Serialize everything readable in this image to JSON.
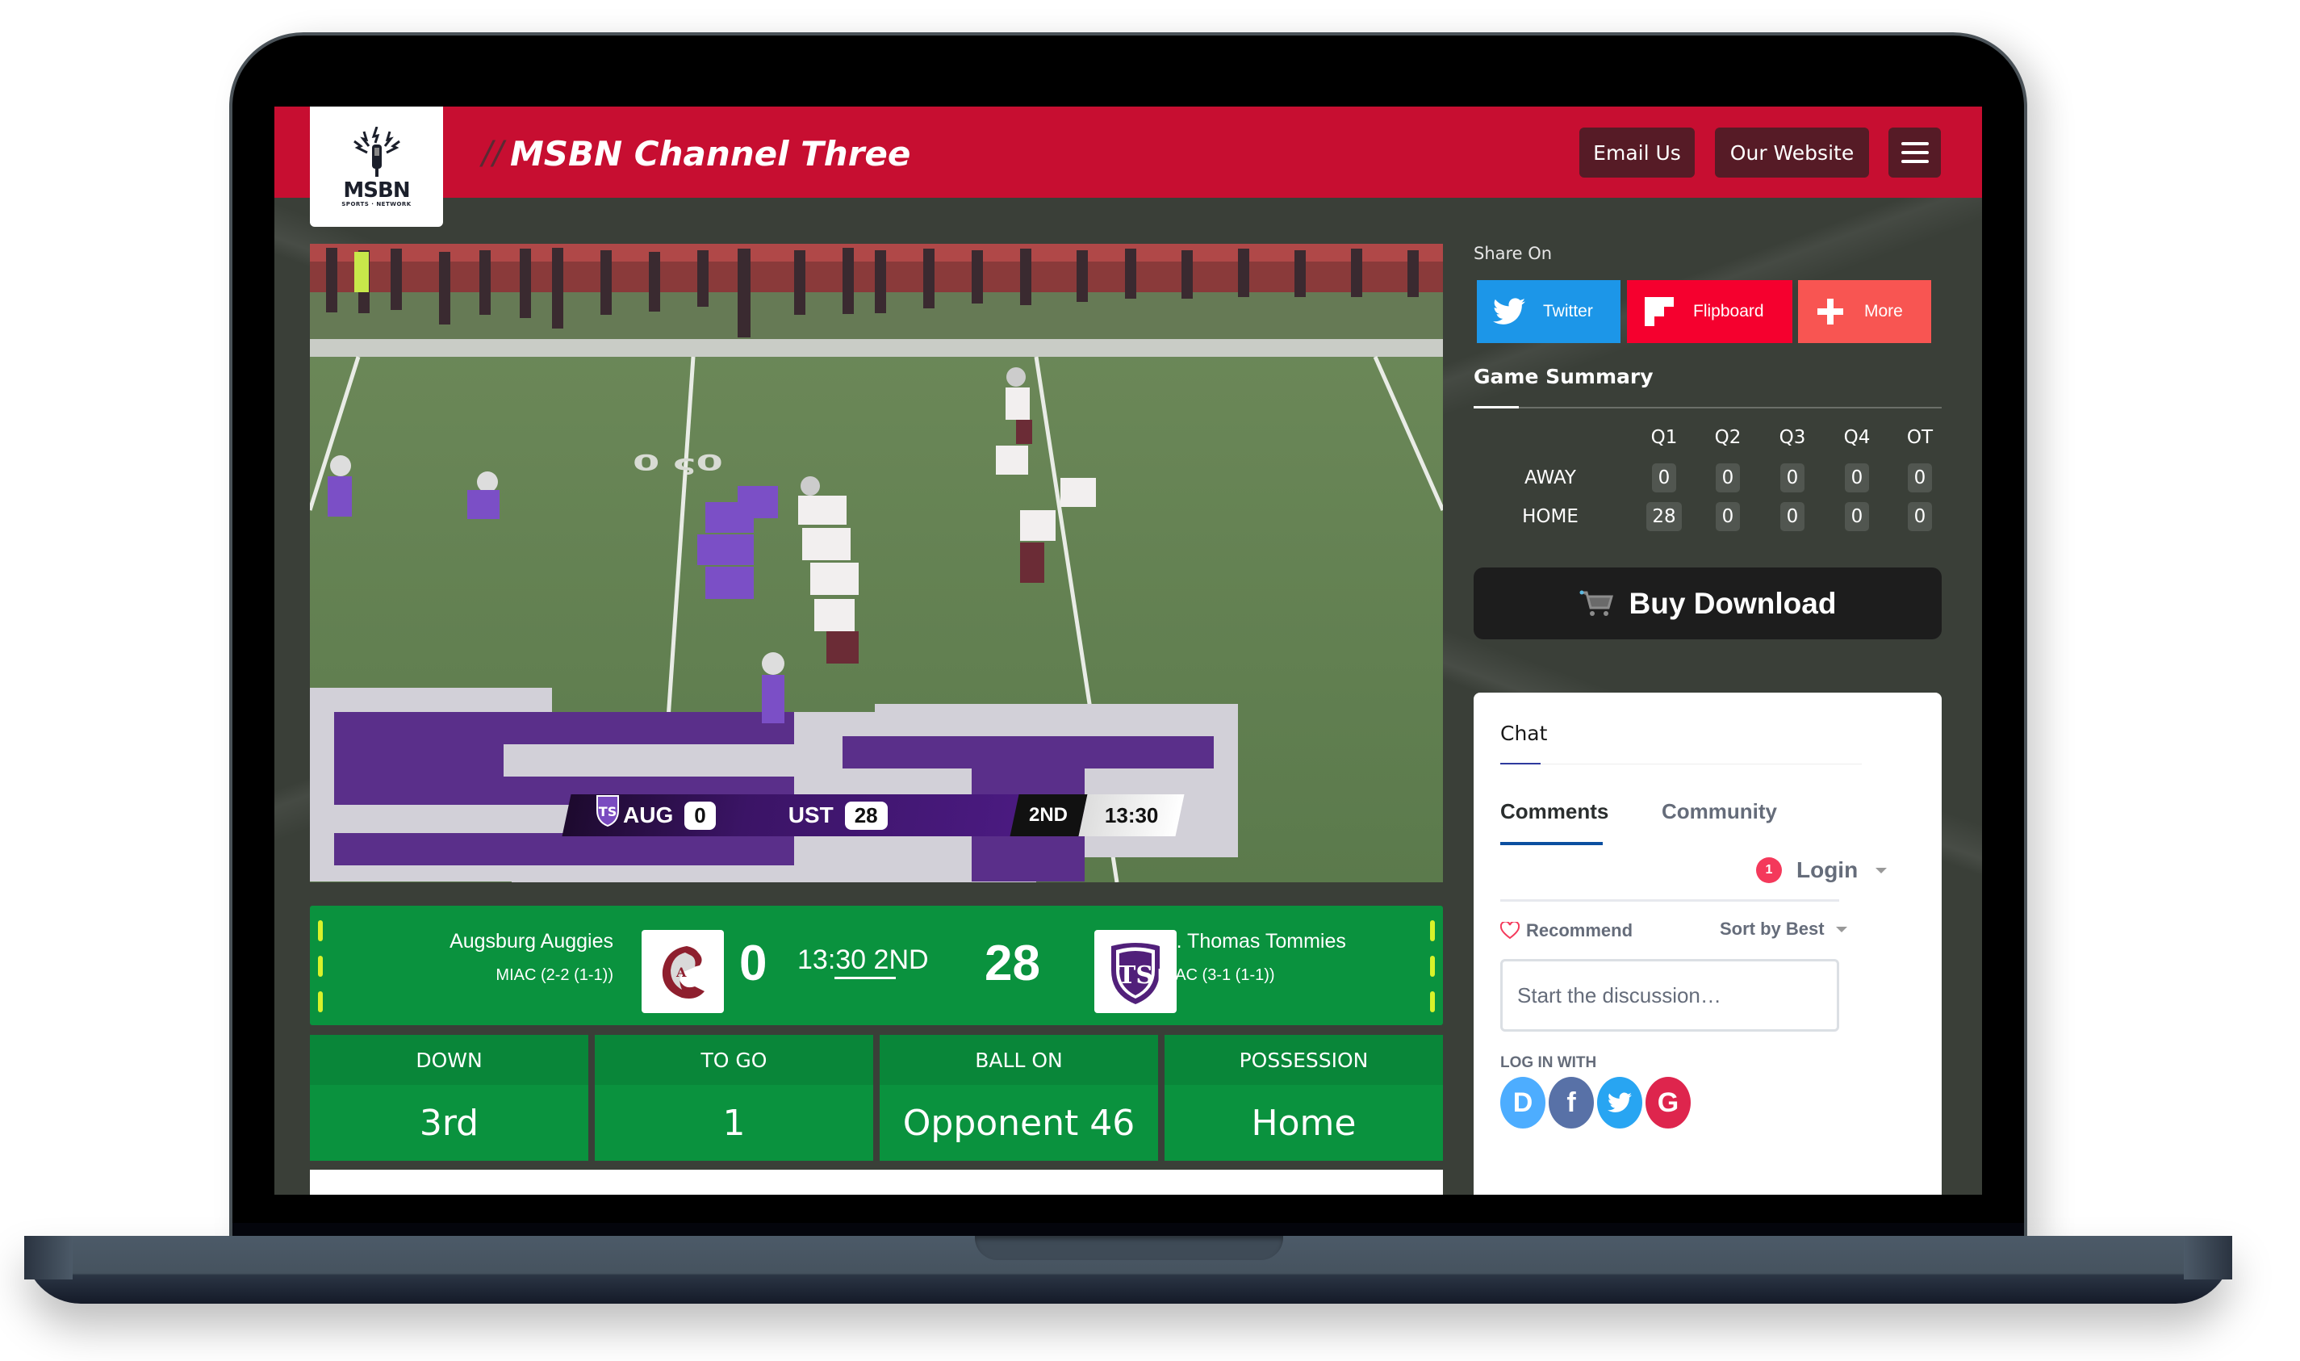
{
  "header": {
    "logo_text": "MSBN",
    "logo_subtext": "SPORTS · NETWORK",
    "title_prefix": "//",
    "title": "MSBN Channel Three",
    "buttons": {
      "email": "Email Us",
      "website": "Our Website"
    },
    "menu_icon": "hamburger-icon"
  },
  "video": {
    "score_bug": {
      "away_abbr": "AUG",
      "away_score": "0",
      "home_abbr": "UST",
      "home_score": "28",
      "period": "2ND",
      "clock": "13:30"
    }
  },
  "scoreboard": {
    "away": {
      "name": "Augsburg Auggies",
      "conference": "MIAC (2-2 (1-1))",
      "score": "0"
    },
    "home": {
      "name": "St. Thomas Tommies",
      "conference": "MIAC (3-1 (1-1))",
      "score": "28"
    },
    "clock": "13:30 2ND",
    "colors": {
      "field_green": "#0a923e",
      "yard_marker": "#d8f22a"
    }
  },
  "situation": [
    {
      "label": "DOWN",
      "value": "3rd"
    },
    {
      "label": "TO GO",
      "value": "1"
    },
    {
      "label": "BALL ON",
      "value": "Opponent 46"
    },
    {
      "label": "POSSESSION",
      "value": "Home"
    }
  ],
  "share": {
    "label": "Share On",
    "buttons": [
      {
        "label": "Twitter",
        "icon": "twitter-icon",
        "color": "#1c96e8"
      },
      {
        "label": "Flipboard",
        "icon": "flipboard-icon",
        "color": "#f5002e"
      },
      {
        "label": "More",
        "icon": "plus-icon",
        "color": "#f85552"
      }
    ]
  },
  "game_summary": {
    "title": "Game Summary",
    "columns": [
      "Q1",
      "Q2",
      "Q3",
      "Q4",
      "OT"
    ],
    "rows": [
      {
        "label": "AWAY",
        "values": [
          "0",
          "0",
          "0",
          "0",
          "0"
        ]
      },
      {
        "label": "HOME",
        "values": [
          "28",
          "0",
          "0",
          "0",
          "0"
        ]
      }
    ]
  },
  "buy_download": {
    "label": "Buy Download",
    "icon": "cart-icon"
  },
  "chat": {
    "title": "Chat",
    "tabs": [
      "Comments",
      "Community"
    ],
    "active_tab": "Comments",
    "notification_count": "1",
    "login_label": "Login",
    "recommend_label": "Recommend",
    "sort_label": "Sort by Best",
    "discussion_placeholder": "Start the discussion…",
    "login_with_label": "LOG IN WITH",
    "providers": [
      {
        "name": "Disqus",
        "glyph": "D"
      },
      {
        "name": "Facebook",
        "glyph": "f"
      },
      {
        "name": "Twitter",
        "glyph": ""
      },
      {
        "name": "Google",
        "glyph": "G"
      }
    ]
  }
}
